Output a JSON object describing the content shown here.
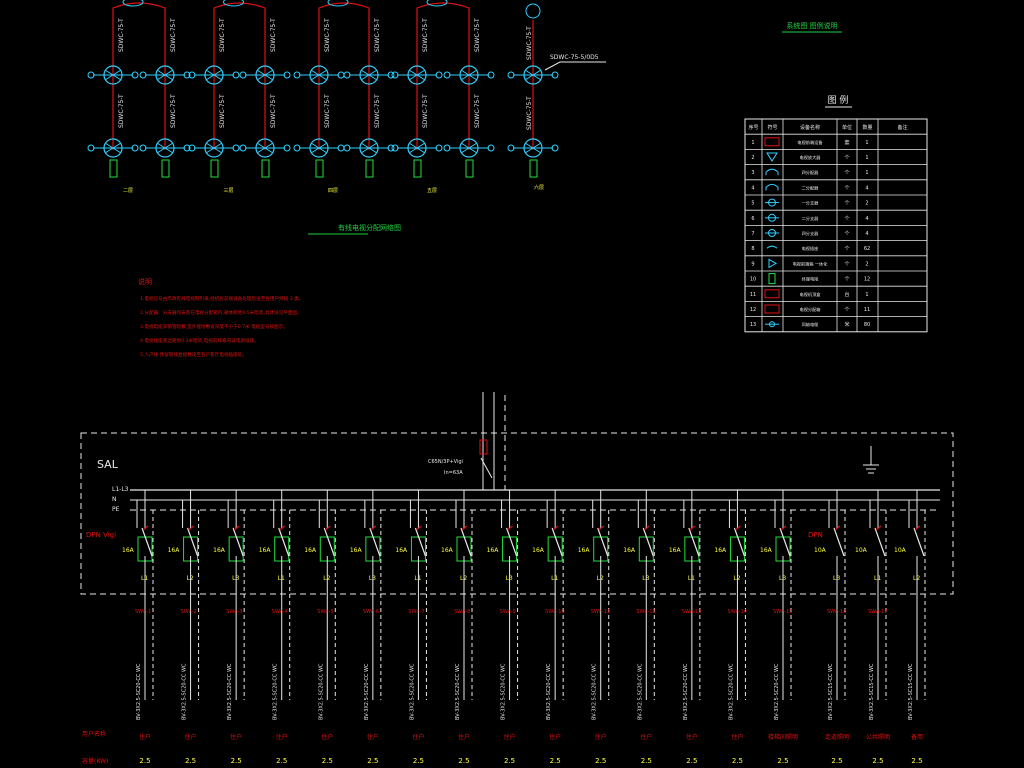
{
  "colors": {
    "background": "#000000",
    "pipe_red": "#e01010",
    "green": "#20e040",
    "cyan": "#30d0ff",
    "white": "#e8e8e8",
    "yellow": "#ffff40",
    "title_green": "#20d040"
  },
  "riser_diagram": {
    "pipe_label": "SDWC-75-T",
    "stub_label": "SDWC-75-5/0D5",
    "floor_labels": [
      "二层",
      "三层",
      "四层",
      "五层",
      "六层"
    ],
    "caption": "有线电视分配网络图"
  },
  "corner_title": "系统图 图例说明",
  "legend": {
    "title": "图 例",
    "headers": [
      "序号",
      "符号",
      "设备名称",
      "单位",
      "数量",
      "备注"
    ],
    "rows": [
      {
        "no": "1",
        "symbol": "box",
        "name": "电视前端设备",
        "unit": "套",
        "qty": "1"
      },
      {
        "no": "2",
        "symbol": "triangle",
        "name": "电视放大器",
        "unit": "个",
        "qty": "1"
      },
      {
        "no": "3",
        "symbol": "bridge",
        "name": "四分配器",
        "unit": "个",
        "qty": "1"
      },
      {
        "no": "4",
        "symbol": "bridge",
        "name": "二分配器",
        "unit": "个",
        "qty": "4"
      },
      {
        "no": "5",
        "symbol": "diamond",
        "name": "一分支器",
        "unit": "个",
        "qty": "2"
      },
      {
        "no": "6",
        "symbol": "diamond",
        "name": "二分支器",
        "unit": "个",
        "qty": "4"
      },
      {
        "no": "7",
        "symbol": "diamond",
        "name": "四分支器",
        "unit": "个",
        "qty": "4"
      },
      {
        "no": "8",
        "symbol": "outlet",
        "name": "电视插座",
        "unit": "个",
        "qty": "62"
      },
      {
        "no": "9",
        "symbol": "play",
        "name": "电视前端箱 一体化",
        "unit": "个",
        "qty": "2"
      },
      {
        "no": "10",
        "symbol": "rect",
        "name": "终端电阻",
        "unit": "个",
        "qty": "12"
      },
      {
        "no": "11",
        "symbol": "redbox",
        "name": "电视机顶盒",
        "unit": "台",
        "qty": "1"
      },
      {
        "no": "12",
        "symbol": "redbox",
        "name": "电视分配箱",
        "unit": "个",
        "qty": "11"
      },
      {
        "no": "13",
        "symbol": "cable",
        "name": "同轴电缆",
        "unit": "米",
        "qty": "80"
      }
    ]
  },
  "notes": {
    "title": "说明",
    "lines": [
      "1.电视信号由市政有线电视网引来,经机房前端设备处理后送至各用户终端 3 类。",
      "2.分配器、分支器均安装在电视分配箱内,箱体距地0.5米暗装,具体详见平面图。",
      "3.电视电缆穿钢管暗敷,室外埋地敷设深度不小于0.7米 电缆型号按图示。",
      "4.电视插座底边距地0.3米暗装,电视前端箱内设电源插座。",
      "5.入户线 预留管线直接敷设至各户客厅电视插座处。"
    ]
  },
  "distribution_panel": {
    "box_label": "SAL",
    "bus_labels": [
      "L1-L3",
      "N",
      "PE"
    ],
    "left_breaker_label": "DPN Vigi",
    "right_breaker_label": "DPN",
    "main_breaker_label": "C65N/3P+Vigi",
    "main_breaker_rating": "In=63A",
    "breaker_rating": "16A",
    "right_breaker_rating": "10A",
    "cable_spec": "BV-3X2.5-SC20-CC WC",
    "right_cable_spec": "BV-3X2.5-SC15-CC WC",
    "row_labels": {
      "user": "用户名称",
      "power": "容量(KW)"
    },
    "left_circuits": [
      {
        "phase": "L1",
        "id": "SWn-1",
        "name": "住户",
        "power": "2.5"
      },
      {
        "phase": "L2",
        "id": "SWn-2",
        "name": "住户",
        "power": "2.5"
      },
      {
        "phase": "L3",
        "id": "SWn-3",
        "name": "住户",
        "power": "2.5"
      },
      {
        "phase": "L1",
        "id": "SWn-4",
        "name": "住户",
        "power": "2.5"
      },
      {
        "phase": "L2",
        "id": "SWn-5",
        "name": "住户",
        "power": "2.5"
      },
      {
        "phase": "L3",
        "id": "SWn-6",
        "name": "住户",
        "power": "2.5"
      },
      {
        "phase": "L1",
        "id": "SWn-7",
        "name": "住户",
        "power": "2.5"
      },
      {
        "phase": "L2",
        "id": "SWn-8",
        "name": "住户",
        "power": "2.5"
      },
      {
        "phase": "L3",
        "id": "SWn-9",
        "name": "住户",
        "power": "2.5"
      },
      {
        "phase": "L1",
        "id": "SWn-10",
        "name": "住户",
        "power": "2.5"
      },
      {
        "phase": "L2",
        "id": "SWn-11",
        "name": "住户",
        "power": "2.5"
      },
      {
        "phase": "L3",
        "id": "SWn-12",
        "name": "住户",
        "power": "2.5"
      },
      {
        "phase": "L1",
        "id": "SWn-13",
        "name": "住户",
        "power": "2.5"
      },
      {
        "phase": "L2",
        "id": "SWn-14",
        "name": "住户",
        "power": "2.5"
      },
      {
        "phase": "L3",
        "id": "SWn-15",
        "name": "楼梯间照明",
        "power": "2.5"
      }
    ],
    "right_circuits": [
      {
        "phase": "L3",
        "id": "SWn-16",
        "name": "走道照明",
        "power": "2.5"
      },
      {
        "phase": "L1",
        "id": "SWn-17",
        "name": "公共照明",
        "power": "2.5"
      },
      {
        "phase": "L2",
        "id": "",
        "name": "备用",
        "power": "2.5"
      }
    ]
  }
}
